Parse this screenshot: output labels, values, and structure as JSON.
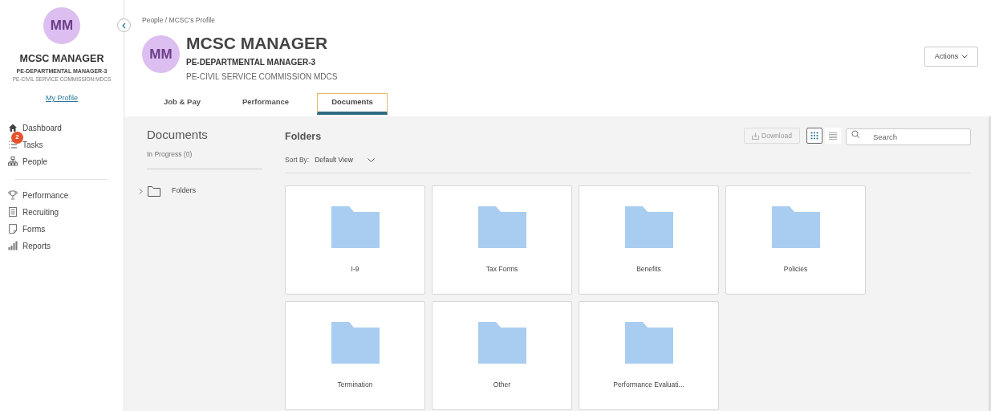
{
  "sidebar": {
    "avatar": "MM",
    "name": "MCSC MANAGER",
    "title": "PE-DEPARTMENTAL MANAGER-3",
    "org": "PE-CIVIL SERVICE COMMISSION MDCS",
    "profile_link": "My Profile",
    "nav_groups": [
      [
        {
          "kind": "home",
          "label": "Dashboard"
        },
        {
          "kind": "tasks",
          "label": "Tasks",
          "badge": "2"
        },
        {
          "kind": "people",
          "label": "People"
        }
      ],
      [
        {
          "kind": "trophy",
          "label": "Performance"
        },
        {
          "kind": "list",
          "label": "Recruiting"
        },
        {
          "kind": "form",
          "label": "Forms"
        },
        {
          "kind": "chart",
          "label": "Reports"
        }
      ]
    ]
  },
  "breadcrumb": "People / MCSC's Profile",
  "profile": {
    "avatar": "MM",
    "name": "MCSC MANAGER",
    "title": "PE-DEPARTMENTAL MANAGER-3",
    "org": "PE-CIVIL SERVICE COMMISSION MDCS"
  },
  "actions_button": "Actions",
  "tabs": [
    {
      "label": "Job & Pay",
      "selected": false
    },
    {
      "label": "Performance",
      "selected": false
    },
    {
      "label": "Documents",
      "selected": true
    }
  ],
  "documents_panel": {
    "title": "Documents",
    "in_progress": "In Progress (0)",
    "tree": [
      {
        "label": "Folders",
        "expanded": false
      }
    ]
  },
  "folders": {
    "title": "Folders",
    "sort_label": "Sort By:",
    "sort_value": "Default View",
    "download": {
      "label": "Download",
      "disabled": true
    },
    "views": [
      {
        "kind": "grid",
        "selected": true
      },
      {
        "kind": "list",
        "selected": false
      }
    ],
    "search": {
      "placeholder": "Search"
    },
    "items": [
      {
        "name": "I-9"
      },
      {
        "name": "Tax Forms"
      },
      {
        "name": "Benefits"
      },
      {
        "name": "Policies"
      },
      {
        "name": "Termination"
      },
      {
        "name": "Other"
      },
      {
        "name": "Performance Evaluati..."
      }
    ]
  }
}
